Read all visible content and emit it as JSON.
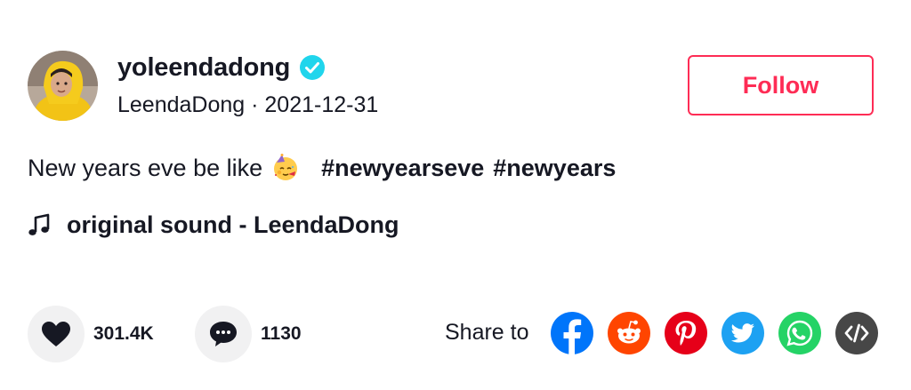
{
  "author": {
    "username": "yoleendadong",
    "verified": true,
    "subline": "LeendaDong · 2021-12-31"
  },
  "follow_button": {
    "label": "Follow"
  },
  "caption": {
    "text": "New years eve be like",
    "emoji": "partying-face",
    "hashtags": [
      "#newyearseve",
      "#newyears"
    ]
  },
  "music": {
    "label": "original sound - LeendaDong"
  },
  "stats": {
    "likes": "301.4K",
    "comments": "1130"
  },
  "share": {
    "label": "Share to",
    "targets": [
      "facebook",
      "reddit",
      "pinterest",
      "twitter",
      "whatsapp",
      "embed"
    ]
  },
  "colors": {
    "accent": "#fe2c55",
    "verified": "#20d5ec",
    "facebook": "#0075fa",
    "reddit": "#ff4500",
    "pinterest": "#e60019",
    "twitter": "#1da1f2",
    "whatsapp": "#25d366",
    "embed": "#474747"
  }
}
